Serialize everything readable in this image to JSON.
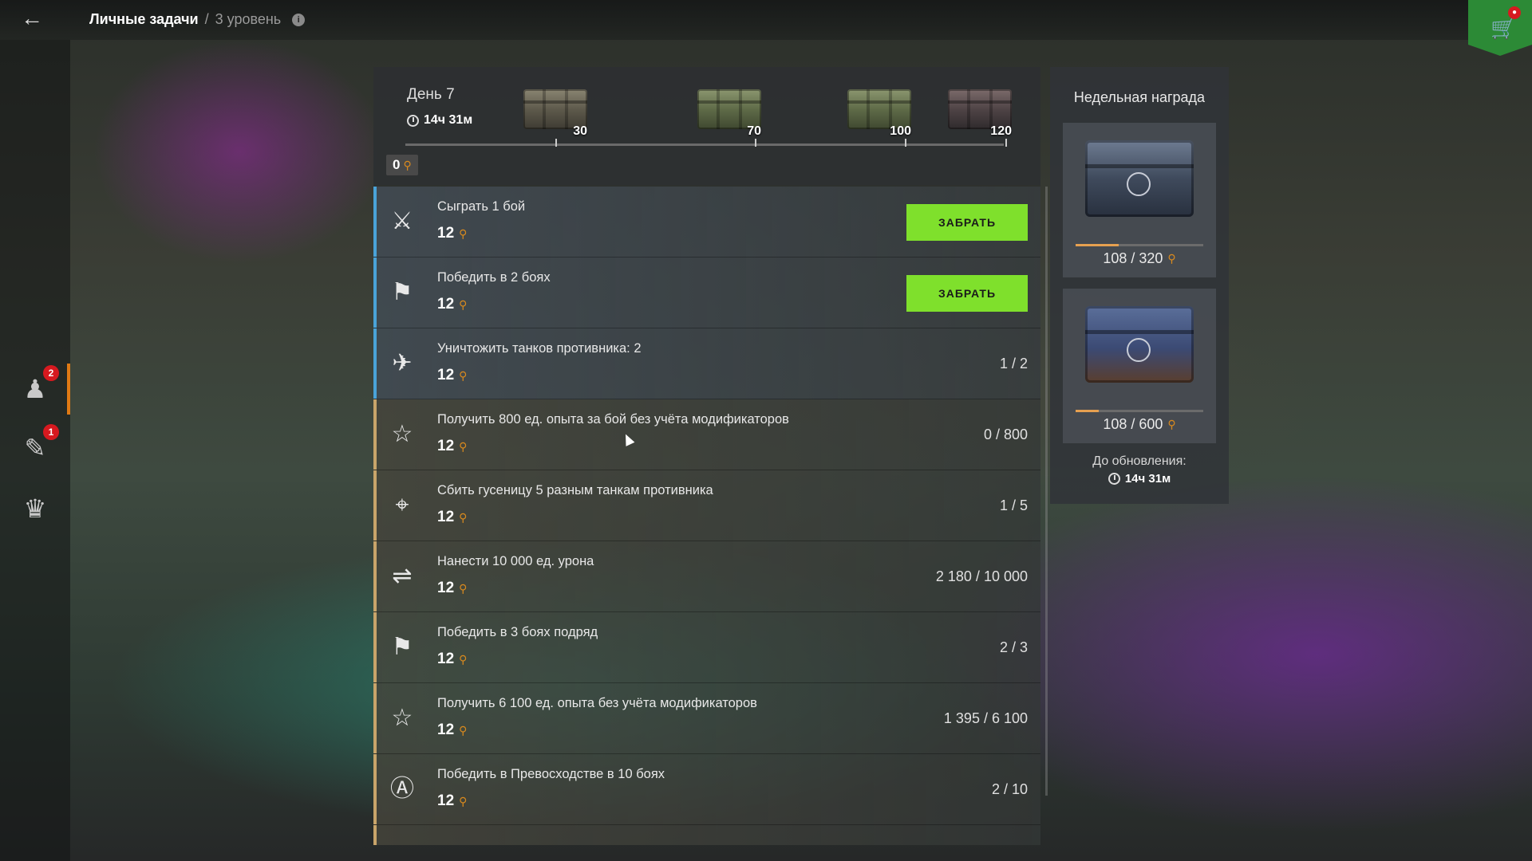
{
  "header": {
    "breadcrumb_main": "Личные задачи",
    "breadcrumb_sep": "/",
    "breadcrumb_sub": "3 уровень",
    "info_icon": "i"
  },
  "left_rail": [
    {
      "icon": "person-icon",
      "badge": "2",
      "active": true
    },
    {
      "icon": "ticket-icon",
      "badge": "1",
      "active": false
    },
    {
      "icon": "clan-icon",
      "badge": "",
      "active": false
    }
  ],
  "track": {
    "day": "День 7",
    "timer": "14ч 31м",
    "points": "0",
    "milestones": [
      {
        "value": "30",
        "crate": "brown"
      },
      {
        "value": "70",
        "crate": "green"
      },
      {
        "value": "100",
        "crate": "green"
      },
      {
        "value": "120",
        "crate": "dark"
      }
    ]
  },
  "claim_label": "ЗАБРАТЬ",
  "tasks": [
    {
      "icon": "crossed-swords-icon",
      "title": "Сыграть 1 бой",
      "reward": "12",
      "progress": "",
      "claim": true,
      "accent": "blue"
    },
    {
      "icon": "victory-flag-icon",
      "title": "Победить в 2 боях",
      "reward": "12",
      "progress": "",
      "claim": true,
      "accent": "blue"
    },
    {
      "icon": "destroyed-tank-icon",
      "title": "Уничтожить танков противника: 2",
      "reward": "12",
      "progress": "1 / 2",
      "claim": false,
      "accent": "blue"
    },
    {
      "icon": "star-icon",
      "title": "Получить 800 ед. опыта за бой без учёта модификаторов",
      "reward": "12",
      "progress": "0 / 800",
      "claim": false,
      "accent": "gold"
    },
    {
      "icon": "crosshair-icon",
      "title": "Сбить гусеницу 5 разным танкам противника",
      "reward": "12",
      "progress": "1 / 5",
      "claim": false,
      "accent": "gold"
    },
    {
      "icon": "damage-icon",
      "title": "Нанести 10 000 ед. урона",
      "reward": "12",
      "progress": "2 180 / 10 000",
      "claim": false,
      "accent": "gold"
    },
    {
      "icon": "victory-flag-icon",
      "title": "Победить в 3 боях подряд",
      "reward": "12",
      "progress": "2 / 3",
      "claim": false,
      "accent": "gold"
    },
    {
      "icon": "star-icon",
      "title": "Получить 6 100 ед. опыта без учёта модификаторов",
      "reward": "12",
      "progress": "1 395 / 6 100",
      "claim": false,
      "accent": "gold"
    },
    {
      "icon": "supremacy-icon",
      "title": "Победить в Превосходстве в 10 боях",
      "reward": "12",
      "progress": "2 / 10",
      "claim": false,
      "accent": "gold"
    }
  ],
  "weekly": {
    "title": "Недельная награда",
    "rewards": [
      {
        "current": 108,
        "target": 320,
        "text": "108 / 320",
        "fill": 0.3375
      },
      {
        "current": 108,
        "target": 600,
        "text": "108 / 600",
        "fill": 0.18
      }
    ],
    "update_label": "До обновления:",
    "update_timer": "14ч 31м"
  }
}
